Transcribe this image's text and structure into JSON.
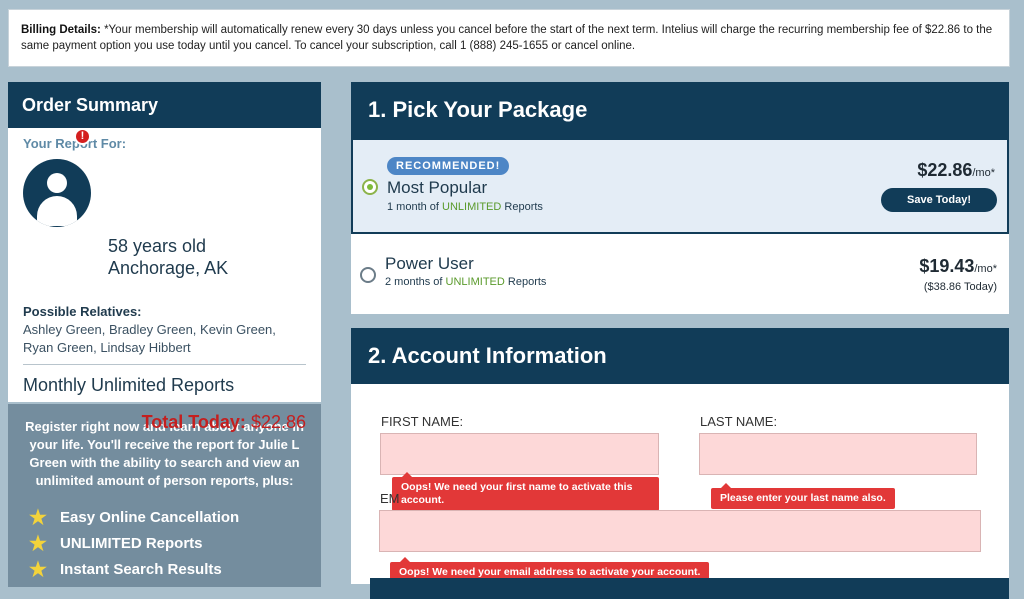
{
  "billing": {
    "label": "Billing Details:",
    "text": "*Your membership will automatically renew every 30 days unless you cancel before the start of the next term. Intelius will charge the recurring membership fee of $22.86 to the same payment option you use today until you cancel. To cancel your subscription, call 1 (888) 245-1655 or cancel online."
  },
  "order_summary": {
    "title": "Order Summary",
    "report_for": "Your Report For:",
    "age": "58 years old",
    "location": "Anchorage, AK",
    "alert_icon": "!",
    "relatives_label": "Possible Relatives:",
    "relatives": "Ashley Green, Bradley Green, Kevin Green, Ryan Green, Lindsay Hibbert",
    "plan_name": "Monthly Unlimited Reports",
    "total_label": "Total Today:",
    "total_value": "$22.86"
  },
  "promo": {
    "text": "Register right now and learn about anyone in your life. You'll receive the report for Julie L Green with the ability to search and view an unlimited amount of person reports, plus:",
    "star_icon": "★",
    "features": [
      "Easy Online Cancellation",
      "UNLIMITED Reports",
      "Instant Search Results"
    ]
  },
  "packages": {
    "title": "1. Pick Your Package",
    "items": [
      {
        "badge": "RECOMMENDED!",
        "name": "Most Popular",
        "sub_prefix": "1 month of",
        "sub_unlimited": "UNLIMITED",
        "sub_suffix": "Reports",
        "price": "$22.86",
        "per": "/mo*",
        "button": "Save Today!",
        "selected": true
      },
      {
        "name": "Power User",
        "sub_prefix": "2 months of",
        "sub_unlimited": "UNLIMITED",
        "sub_suffix": "Reports",
        "price": "$19.43",
        "per": "/mo*",
        "today": "($38.86 Today)",
        "selected": false
      }
    ]
  },
  "account": {
    "title": "2. Account Information",
    "first_name_label": "FIRST NAME:",
    "last_name_label": "LAST NAME:",
    "email_label": "EM",
    "first_name_error": "Oops! We need your first name to activate this account.",
    "last_name_error": "Please enter your last name also.",
    "email_error": "Oops! We need your email address to activate your account."
  },
  "colors": {
    "header": "#113c58",
    "background": "#a9bfcc",
    "error": "#e23838",
    "field_error_bg": "#fdd8d8",
    "total_red": "#c41f1f",
    "unlimited_green": "#5a9a2b"
  }
}
